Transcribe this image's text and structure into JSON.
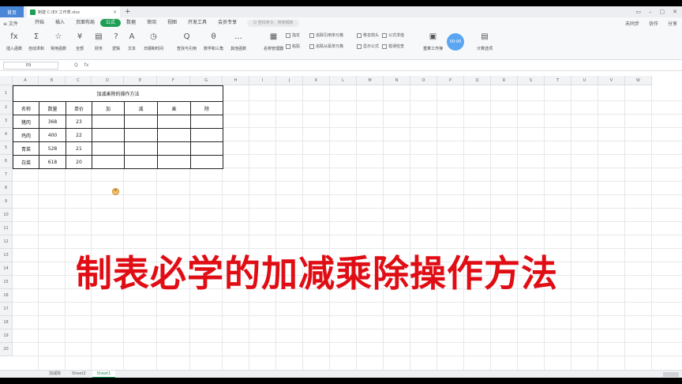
{
  "titlebar": {
    "home_tab": "首页",
    "doc_tab_name": "制建 C:\\EX 工作表.xlsx",
    "close_glyph": "×",
    "new_tab_glyph": "+",
    "window_controls": [
      "▭",
      "–",
      "▢",
      "✕"
    ]
  },
  "menubar": {
    "file_label": "≡ 文件",
    "menu_items": [
      "开始",
      "插入",
      "页面布局",
      "公式",
      "数据",
      "审阅",
      "视图",
      "开发工具",
      "会员专享"
    ],
    "active_item": "公式",
    "search_placeholder": "Q 查找命令、搜索模板",
    "right_items": [
      "未同步",
      "协作",
      "分享"
    ]
  },
  "ribbon": {
    "buttons": [
      {
        "icon": "fx",
        "label": "插入函数"
      },
      {
        "icon": "Σ",
        "label": "自动求和"
      },
      {
        "icon": "☆",
        "label": "常用函数"
      },
      {
        "icon": "¥",
        "label": "全部"
      },
      {
        "icon": "▤",
        "label": "财务"
      },
      {
        "icon": "?",
        "label": "逻辑"
      },
      {
        "icon": "A",
        "label": "文本"
      },
      {
        "icon": "◷",
        "label": "日期和时间"
      },
      {
        "icon": "Q",
        "label": "查找与引用"
      },
      {
        "icon": "θ",
        "label": "数学和三角"
      },
      {
        "icon": "…",
        "label": "其他函数"
      },
      {
        "icon": "▦",
        "label": "名称管理器"
      }
    ],
    "small_items": [
      "指定",
      "粘贴",
      "追踪引用单元格",
      "追踪从属单元格",
      "移去箭头",
      "显示公式",
      "公式求值",
      "错误检查"
    ],
    "calc_label": "重算工作簿",
    "calc_options_label": "计算选项",
    "timer": "00:00"
  },
  "formula_bar": {
    "cell_ref": "E9",
    "fx_symbol": "fx",
    "zoom_symbol": "Q"
  },
  "columns": [
    "A",
    "B",
    "C",
    "D",
    "E",
    "F",
    "G",
    "H",
    "I",
    "J",
    "K",
    "L",
    "M",
    "N",
    "O",
    "P",
    "Q",
    "R",
    "S",
    "T",
    "U",
    "V",
    "W"
  ],
  "rows": [
    "1",
    "2",
    "3",
    "4",
    "5",
    "6",
    "7",
    "8",
    "9",
    "10",
    "11",
    "12",
    "13",
    "14",
    "15",
    "16",
    "17",
    "18",
    "19",
    "20"
  ],
  "table": {
    "title": "加减乘除的操作方法",
    "headers": [
      "名称",
      "数量",
      "单价",
      "加",
      "减",
      "乘",
      "除"
    ],
    "rows": [
      [
        "猪肉",
        "368",
        "23",
        "",
        "",
        "",
        ""
      ],
      [
        "鸡肉",
        "400",
        "22",
        "",
        "",
        "",
        ""
      ],
      [
        "青菜",
        "528",
        "21",
        "",
        "",
        "",
        ""
      ],
      [
        "白菜",
        "618",
        "20",
        "",
        "",
        "",
        ""
      ]
    ]
  },
  "overlay_caption": "制表必学的加减乘除操作方法",
  "sheets": [
    "加减除",
    "Sheet2",
    "Sheet1"
  ],
  "active_sheet": "Sheet1",
  "colors": {
    "accent": "#1e9e55",
    "caption": "#e00d14",
    "home_tab": "#4a86d8"
  }
}
